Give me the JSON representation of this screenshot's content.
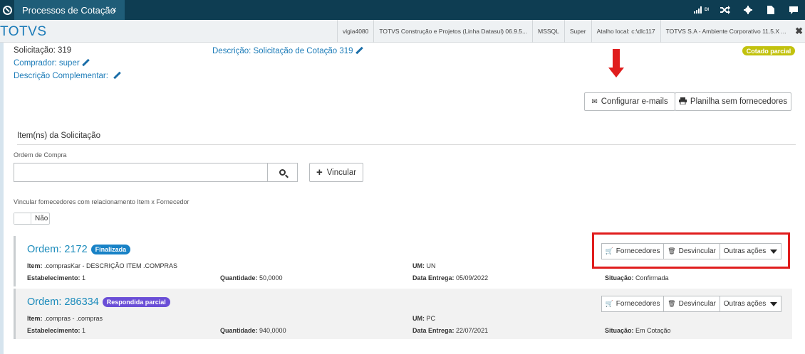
{
  "topbar": {
    "tab_title": "Processos de Cotação",
    "tab_close": "×",
    "icons": [
      "signal-bars-icon",
      "shuffle-icon",
      "gear-icon",
      "document-icon",
      "chat-icon"
    ],
    "signal_label": "DI"
  },
  "secbar": {
    "brand": "TOTVS",
    "info": [
      "vigia4080",
      "TOTVS Construção e Projetos (Linha Datasul) 06.9.5...",
      "MSSQL",
      "Super",
      "Atalho local: c:\\dlc117",
      "TOTVS S.A - Ambiente Corporativo 11.5.X ..."
    ],
    "close": "✖"
  },
  "header": {
    "solicitacao": "Solicitação: 319",
    "descricao": "Descrição: Solicitação de Cotação 319",
    "comprador": "Comprador: super",
    "descricao_complementar": "Descrição Complementar:",
    "status_badge": "Cotado parcial",
    "configurar_emails": "Configurar e-mails",
    "planilha": "Planilha sem fornecedores"
  },
  "itens": {
    "section_title": "Item(ns) da Solicitação",
    "ordem_compra_label": "Ordem de Compra",
    "ordem_compra_value": "",
    "vincular_label": "Vincular",
    "vincular_fornecedores_label": "Vincular fornecedores com relacionamento Item x Fornecedor",
    "toggle_value": "Não"
  },
  "orders": [
    {
      "ordem": "Ordem: 2172",
      "status": "Finalizada",
      "item_label": "Item:",
      "item_value": ".comprasKar - DESCRIÇÃO ITEM .COMPRAS",
      "um_label": "UM:",
      "um_value": "UN",
      "estabelecimento_label": "Estabelecimento:",
      "estabelecimento_value": "1",
      "quantidade_label": "Quantidade:",
      "quantidade_value": "50,0000",
      "data_entrega_label": "Data Entrega:",
      "data_entrega_value": "05/09/2022",
      "situacao_label": "Situação:",
      "situacao_value": "Confirmada"
    },
    {
      "ordem": "Ordem: 286334",
      "status": "Respondida parcial",
      "item_label": "Item:",
      "item_value": ".compras - .compras",
      "um_label": "UM:",
      "um_value": "PC",
      "estabelecimento_label": "Estabelecimento:",
      "estabelecimento_value": "1",
      "quantidade_label": "Quantidade:",
      "quantidade_value": "940,0000",
      "data_entrega_label": "Data Entrega:",
      "data_entrega_value": "22/07/2021",
      "situacao_label": "Situação:",
      "situacao_value": "Em Cotação"
    }
  ],
  "order_actions": {
    "fornecedores": "Fornecedores",
    "desvincular": "Desvincular",
    "outras_acoes": "Outras ações"
  },
  "colors": {
    "topbar": "#0e3d52",
    "tab": "#1f5d78",
    "brand": "#1b7bb8",
    "badge_yellow": "#c2c20e",
    "pill_blue": "#1882c6",
    "pill_purple": "#6a4ed6",
    "annotation_red": "#e01d1d"
  }
}
